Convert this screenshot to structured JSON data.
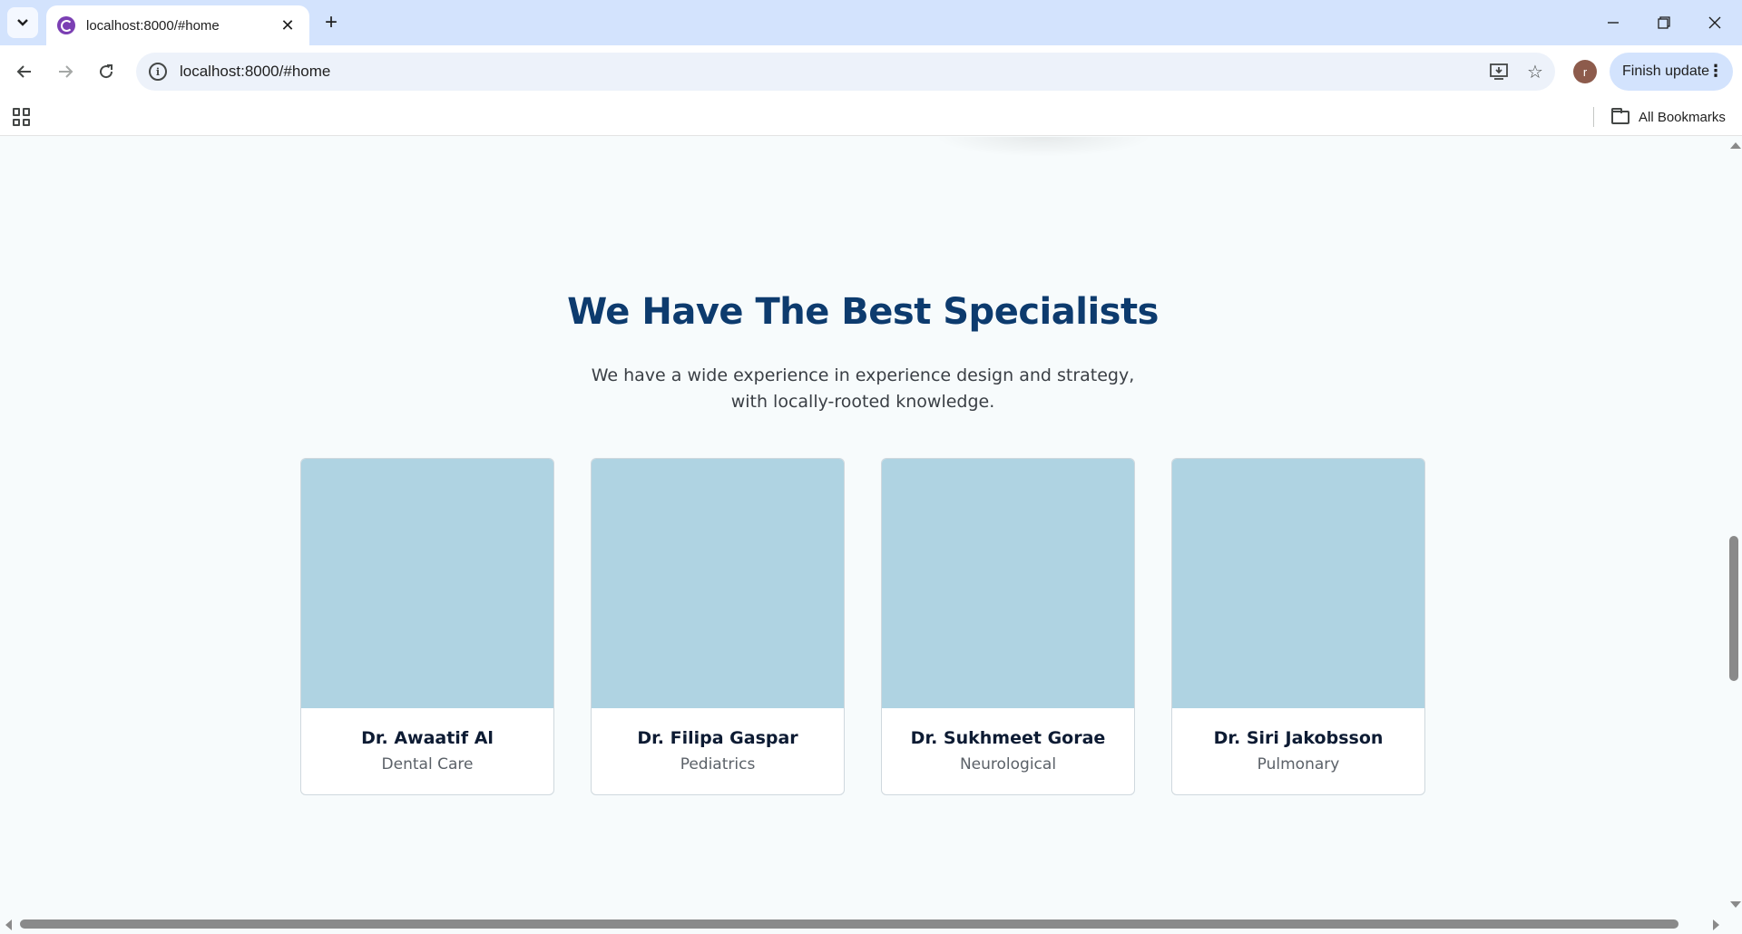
{
  "browser": {
    "tab_title": "localhost:8000/#home",
    "address": "localhost:8000/#home",
    "profile_initial": "r",
    "finish_update_label": "Finish update",
    "bookmarks_label": "All Bookmarks",
    "icons": {
      "tab_search": "chevron-down-icon",
      "favicon": "site-favicon-icon",
      "tab_close": "close-icon",
      "new_tab": "plus-icon",
      "minimize": "minimize-icon",
      "restore": "restore-icon",
      "close_window": "close-icon",
      "back": "arrow-left-icon",
      "forward": "arrow-right-icon",
      "reload": "reload-icon",
      "site_info": "info-icon",
      "install_app": "install-icon",
      "bookmark_star": "star-icon",
      "menu": "kebab-menu-icon",
      "apps": "apps-grid-icon",
      "bookmarks_folder": "folder-icon"
    }
  },
  "section": {
    "title": "We Have The Best Specialists",
    "description_line1": "We have a wide experience in experience design and strategy,",
    "description_line2": "with locally-rooted knowledge."
  },
  "specialists": [
    {
      "name": "Dr. Awaatif Al",
      "specialty": "Dental Care"
    },
    {
      "name": "Dr. Filipa Gaspar",
      "specialty": "Pediatrics"
    },
    {
      "name": "Dr. Sukhmeet Gorae",
      "specialty": "Neurological"
    },
    {
      "name": "Dr. Siri Jakobsson",
      "specialty": "Pulmonary"
    }
  ],
  "colors": {
    "heading": "#0d3b6e",
    "photo_placeholder": "#afd3e2",
    "page_background": "#f7fbfc",
    "tabstrip": "#d3e3fd"
  }
}
